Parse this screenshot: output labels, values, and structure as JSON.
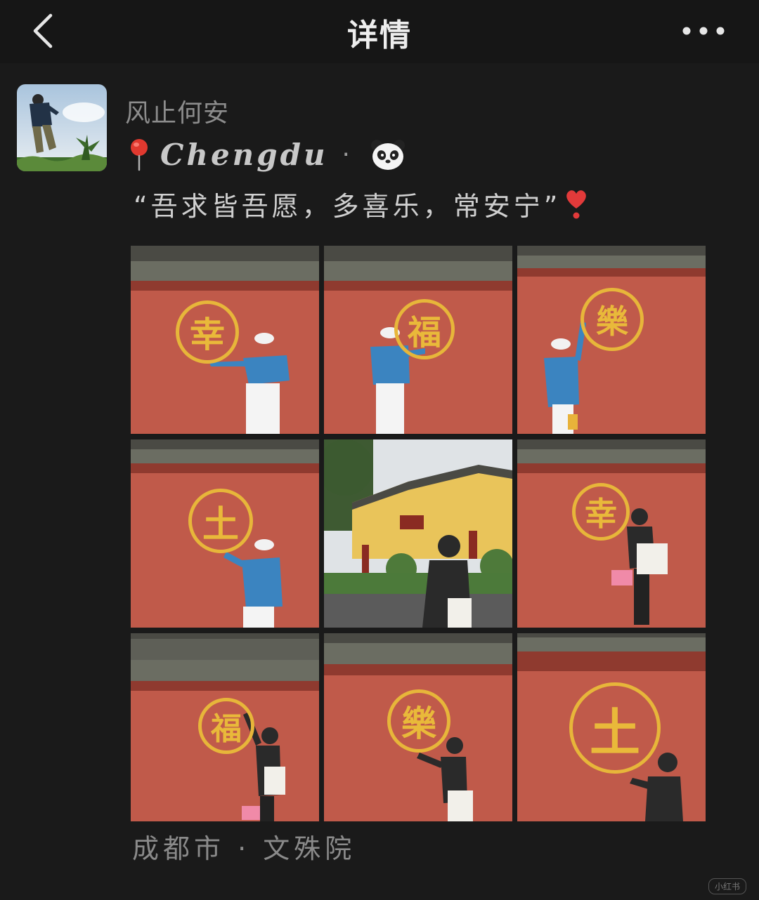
{
  "nav": {
    "title": "详情"
  },
  "post": {
    "username": "风止何安",
    "location_script": "Chengdu",
    "separator": "·",
    "caption": "“吾求皆吾愿，多喜乐，常安宁”",
    "place": "成都市 · 文殊院"
  },
  "photos": [
    {
      "char": "幸",
      "pose": "blue-hoodie-pointing"
    },
    {
      "char": "福",
      "pose": "blue-hoodie-pointing"
    },
    {
      "char": "樂",
      "pose": "blue-hoodie-reaching"
    },
    {
      "char": "土",
      "pose": "blue-hoodie-reaching"
    },
    {
      "char": "",
      "pose": "yellow-temple-back-view"
    },
    {
      "char": "幸",
      "pose": "black-jacket-tote"
    },
    {
      "char": "福",
      "pose": "black-jacket-reaching"
    },
    {
      "char": "樂",
      "pose": "black-jacket-reaching"
    },
    {
      "char": "土",
      "pose": "black-jacket-tote"
    }
  ],
  "watermark": "小红书",
  "icons": [
    "back-chevron-icon",
    "more-dots-icon",
    "pin-icon",
    "panda-icon",
    "heart-icon"
  ],
  "colors": {
    "background": "#1a1a1a",
    "wall_red": "#b8584a",
    "gold": "#e7b63a",
    "text_muted": "#8a8a8a"
  }
}
